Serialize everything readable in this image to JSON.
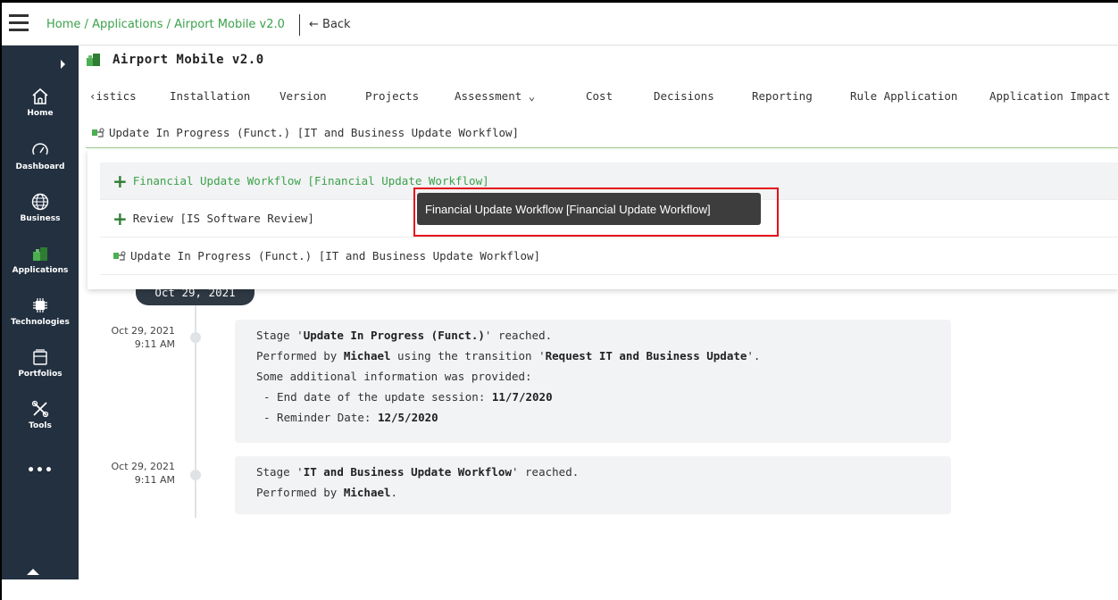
{
  "breadcrumb": {
    "home": "Home",
    "applications": "Applications",
    "current": "Airport Mobile v2.0",
    "separator": "/",
    "back_label": "← Back"
  },
  "sidebar": {
    "items": [
      {
        "label": "Home",
        "icon": "home-icon"
      },
      {
        "label": "Dashboard",
        "icon": "gauge-icon"
      },
      {
        "label": "Business",
        "icon": "globe-icon"
      },
      {
        "label": "Applications",
        "icon": "puzzle-icon"
      },
      {
        "label": "Technologies",
        "icon": "chip-icon"
      },
      {
        "label": "Portfolios",
        "icon": "folder-icon"
      },
      {
        "label": "Tools",
        "icon": "tools-icon"
      }
    ],
    "more_label": "•••"
  },
  "app": {
    "title": "Airport Mobile v2.0"
  },
  "tabs": {
    "prev_label": "istics",
    "items": [
      "Installation",
      "Version",
      "Projects",
      "Assessment",
      "Cost",
      "Decisions",
      "Reporting",
      "Rule Application",
      "Application Impact"
    ]
  },
  "status": {
    "current": "Update In Progress (Funct.) [IT and Business Update Workflow]"
  },
  "dropdown": {
    "items": [
      "Financial Update Workflow [Financial Update Workflow]",
      "Review [IS Software Review]",
      "Update In Progress (Funct.) [IT and Business Update Workflow]"
    ]
  },
  "tooltip": {
    "text": "Financial Update Workflow [Financial Update Workflow]"
  },
  "timeline": {
    "date_header": "Oct 29, 2021",
    "entries": [
      {
        "date": "Oct 29, 2021",
        "time": "9:11 AM",
        "stage_prefix": "Stage '",
        "stage": "Update In Progress (Funct.)",
        "stage_suffix": "' reached.",
        "performed_prefix": "Performed by ",
        "user": "Michael",
        "transition_prefix": " using the transition '",
        "transition": "Request IT and Business Update",
        "transition_suffix": "'.",
        "info_line": "Some additional information was provided:",
        "detail1_label": "- End date of the update session: ",
        "detail1_value": "11/7/2020",
        "detail2_label": "- Reminder Date: ",
        "detail2_value": "12/5/2020"
      },
      {
        "date": "Oct 29, 2021",
        "time": "9:11 AM",
        "stage_prefix": "Stage '",
        "stage": "IT and Business Update Workflow",
        "stage_suffix": "' reached.",
        "performed_prefix": "Performed by ",
        "user": "Michael",
        "performed_suffix": "."
      }
    ]
  },
  "colors": {
    "accent_green": "#3ba24b",
    "sidebar_bg": "#233040",
    "tooltip_bg": "#3d3d3d",
    "highlight_red": "#e5101a"
  }
}
